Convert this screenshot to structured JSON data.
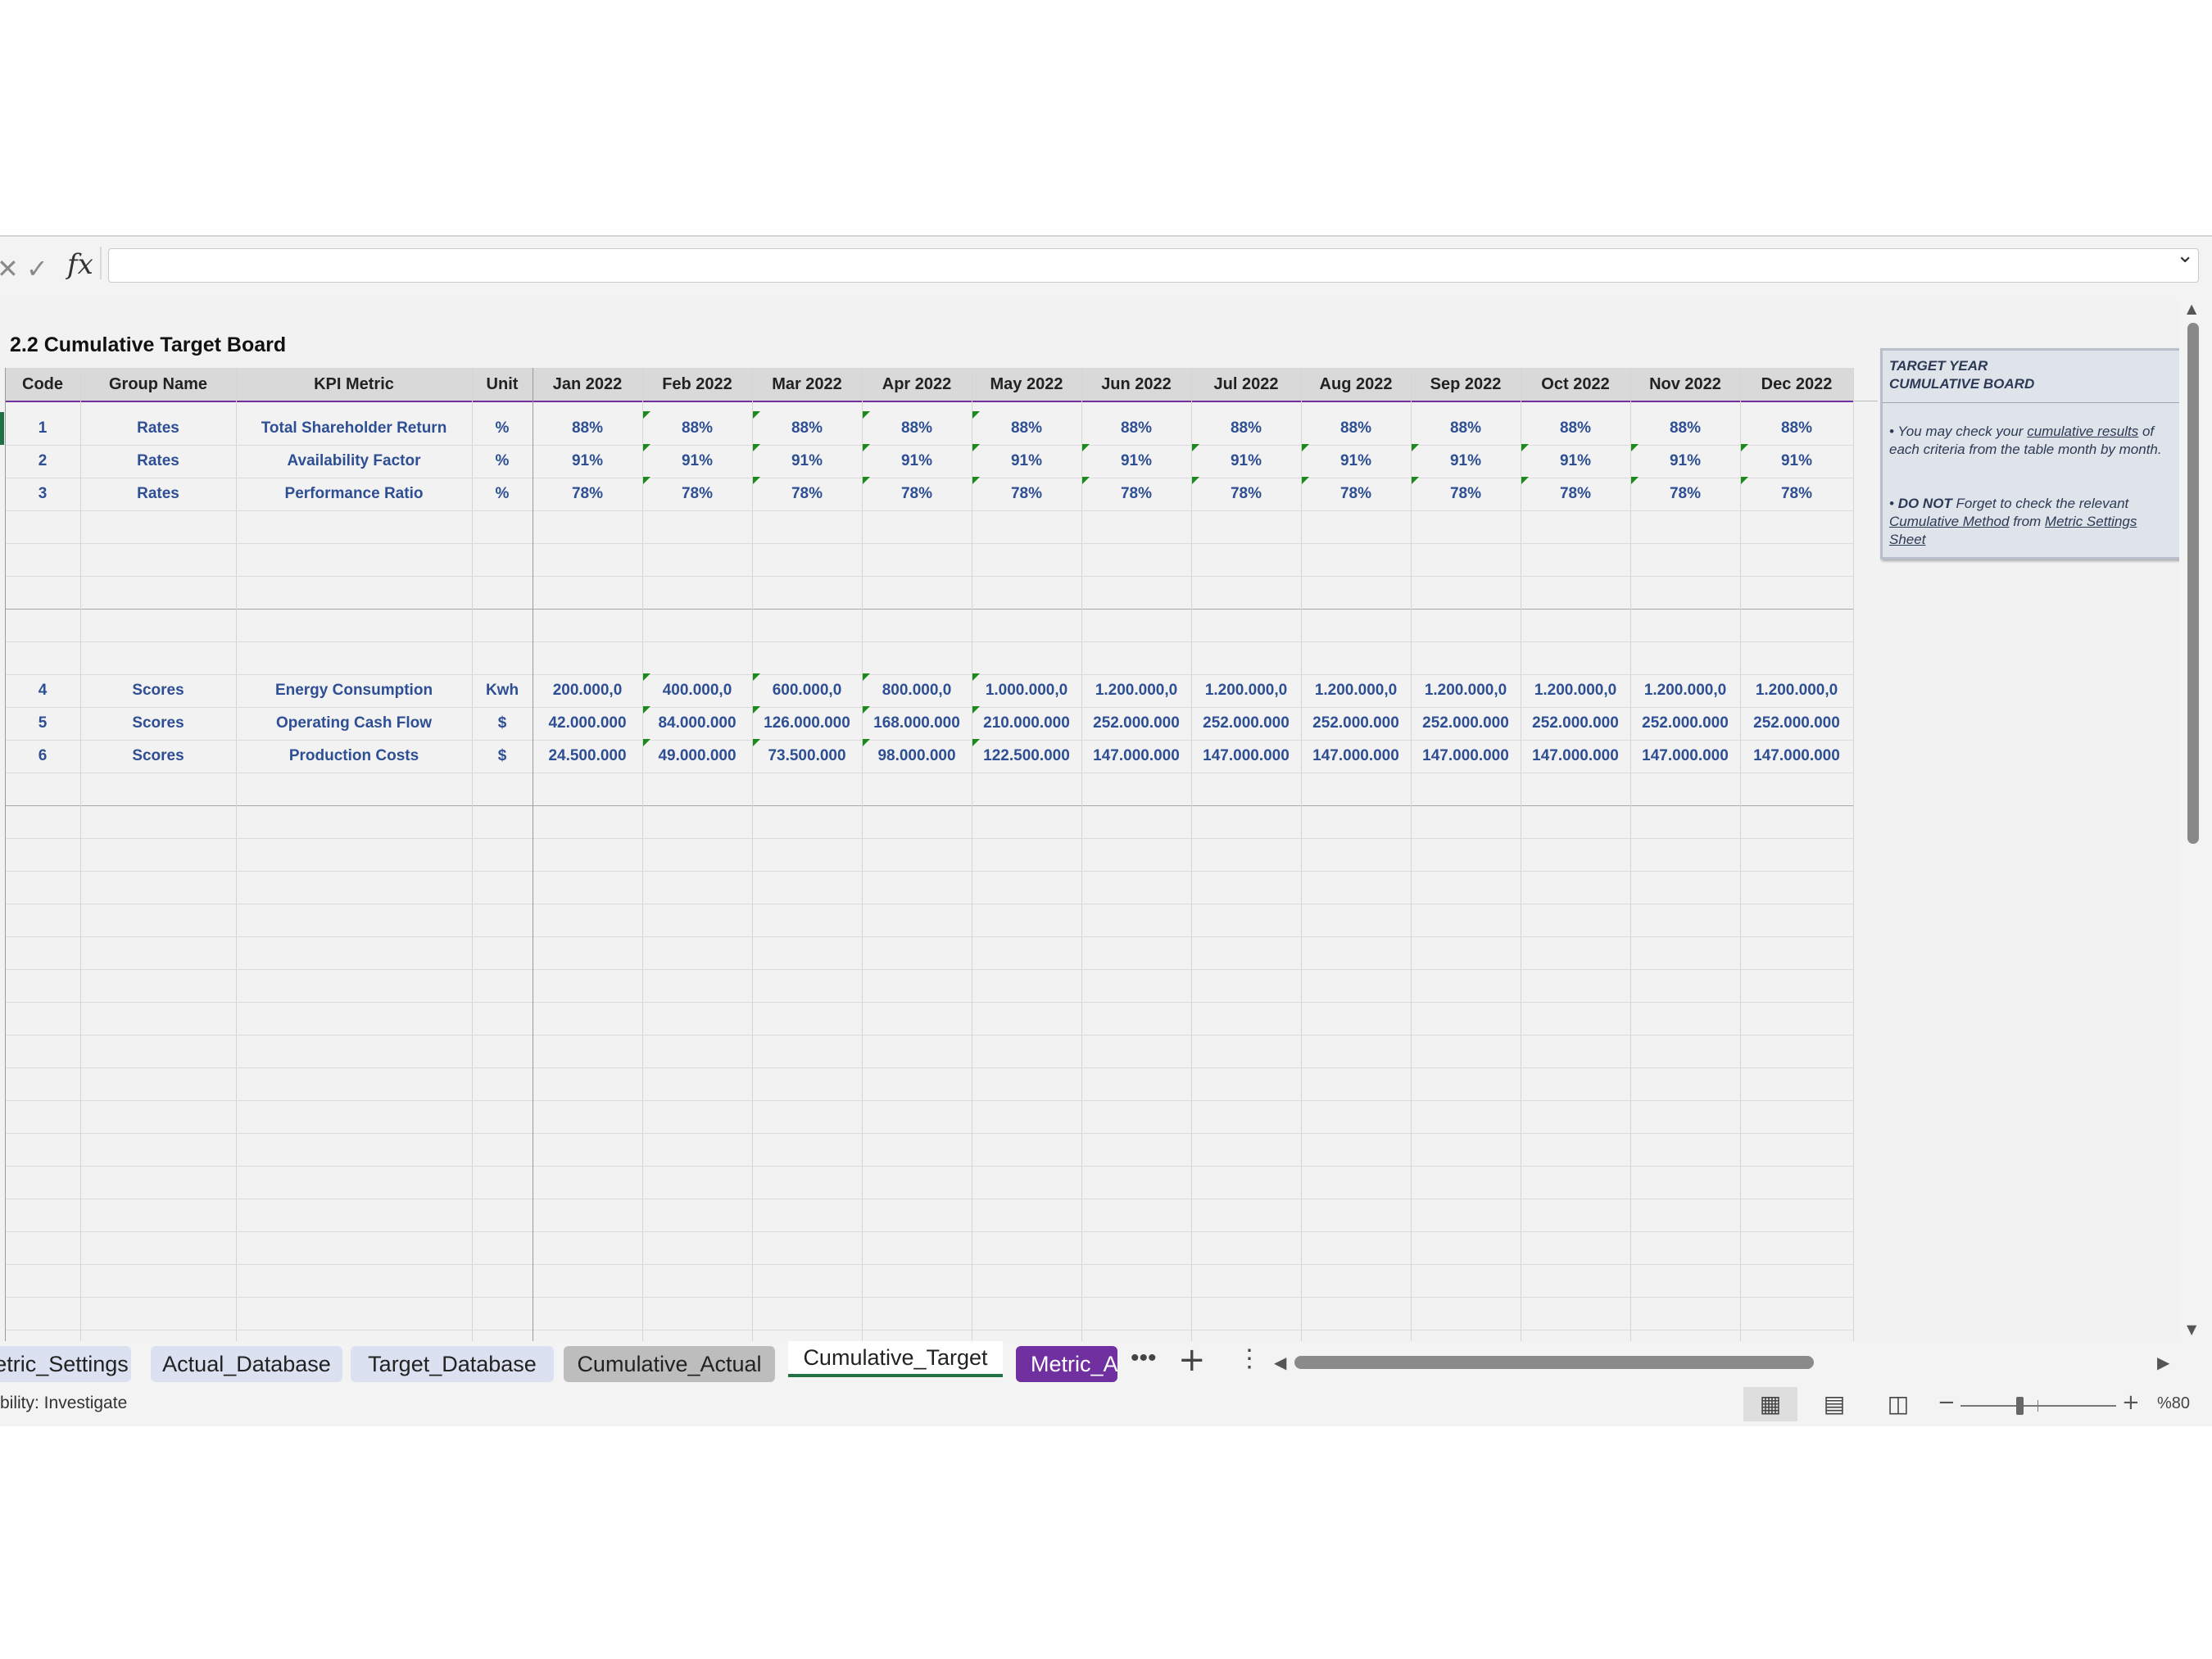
{
  "formula_bar": {
    "fx_label": "fx",
    "value": ""
  },
  "sheet": {
    "title": "2.2 Cumulative Target Board",
    "columns": [
      "Code",
      "Group Name",
      "KPI Metric",
      "Unit",
      "Jan 2022",
      "Feb 2022",
      "Mar 2022",
      "Apr 2022",
      "May 2022",
      "Jun 2022",
      "Jul 2022",
      "Aug 2022",
      "Sep 2022",
      "Oct 2022",
      "Nov 2022",
      "Dec 2022"
    ],
    "rate_rows": [
      [
        "1",
        "Rates",
        "Total Shareholder Return",
        "%",
        "88%",
        "88%",
        "88%",
        "88%",
        "88%",
        "88%",
        "88%",
        "88%",
        "88%",
        "88%",
        "88%",
        "88%"
      ],
      [
        "2",
        "Rates",
        "Availability Factor",
        "%",
        "91%",
        "91%",
        "91%",
        "91%",
        "91%",
        "91%",
        "91%",
        "91%",
        "91%",
        "91%",
        "91%",
        "91%"
      ],
      [
        "3",
        "Rates",
        "Performance Ratio",
        "%",
        "78%",
        "78%",
        "78%",
        "78%",
        "78%",
        "78%",
        "78%",
        "78%",
        "78%",
        "78%",
        "78%",
        "78%"
      ]
    ],
    "score_rows": [
      [
        "4",
        "Scores",
        "Energy Consumption",
        "Kwh",
        "200.000,0",
        "400.000,0",
        "600.000,0",
        "800.000,0",
        "1.000.000,0",
        "1.200.000,0",
        "1.200.000,0",
        "1.200.000,0",
        "1.200.000,0",
        "1.200.000,0",
        "1.200.000,0",
        "1.200.000,0"
      ],
      [
        "5",
        "Scores",
        "Operating Cash Flow",
        "$",
        "42.000.000",
        "84.000.000",
        "126.000.000",
        "168.000.000",
        "210.000.000",
        "252.000.000",
        "252.000.000",
        "252.000.000",
        "252.000.000",
        "252.000.000",
        "252.000.000",
        "252.000.000"
      ],
      [
        "6",
        "Scores",
        "Production Costs",
        "$",
        "24.500.000",
        "49.000.000",
        "73.500.000",
        "98.000.000",
        "122.500.000",
        "147.000.000",
        "147.000.000",
        "147.000.000",
        "147.000.000",
        "147.000.000",
        "147.000.000",
        "147.000.000"
      ]
    ]
  },
  "note": {
    "title": "TARGET YEAR\nCUMULATIVE BOARD",
    "b1_pre": "You may check your ",
    "b1_link": "cumulative results",
    "b1_post": " of each criteria from the table month by month.",
    "b2_bold": "DO NOT",
    "b2_pre": " Forget to check the relevant ",
    "b2_link1": "Cumulative Method",
    "b2_mid": " from ",
    "b2_link2": "Metric Settings Sheet"
  },
  "tabs": [
    {
      "label": "etric_Settings",
      "state": "inactive"
    },
    {
      "label": "Actual_Database",
      "state": "inactive"
    },
    {
      "label": "Target_Database",
      "state": "inactive"
    },
    {
      "label": "Cumulative_Actual",
      "state": "gray"
    },
    {
      "label": "Cumulative_Target",
      "state": "active"
    },
    {
      "label": "Metric_A",
      "state": "purple"
    }
  ],
  "tab_controls": {
    "more": "•••",
    "add": "+",
    "options": "⋮"
  },
  "status": {
    "text": "bility: Investigate",
    "zoom": "%80"
  },
  "colors": {
    "accent_purple": "#7030a0",
    "data_text": "#2e4f93",
    "active_tab_underline": "#217346"
  },
  "icons": [
    "cancel-icon",
    "check-icon",
    "fx-icon",
    "chevron-down-icon",
    "normal-view-icon",
    "page-layout-icon",
    "page-break-icon"
  ]
}
